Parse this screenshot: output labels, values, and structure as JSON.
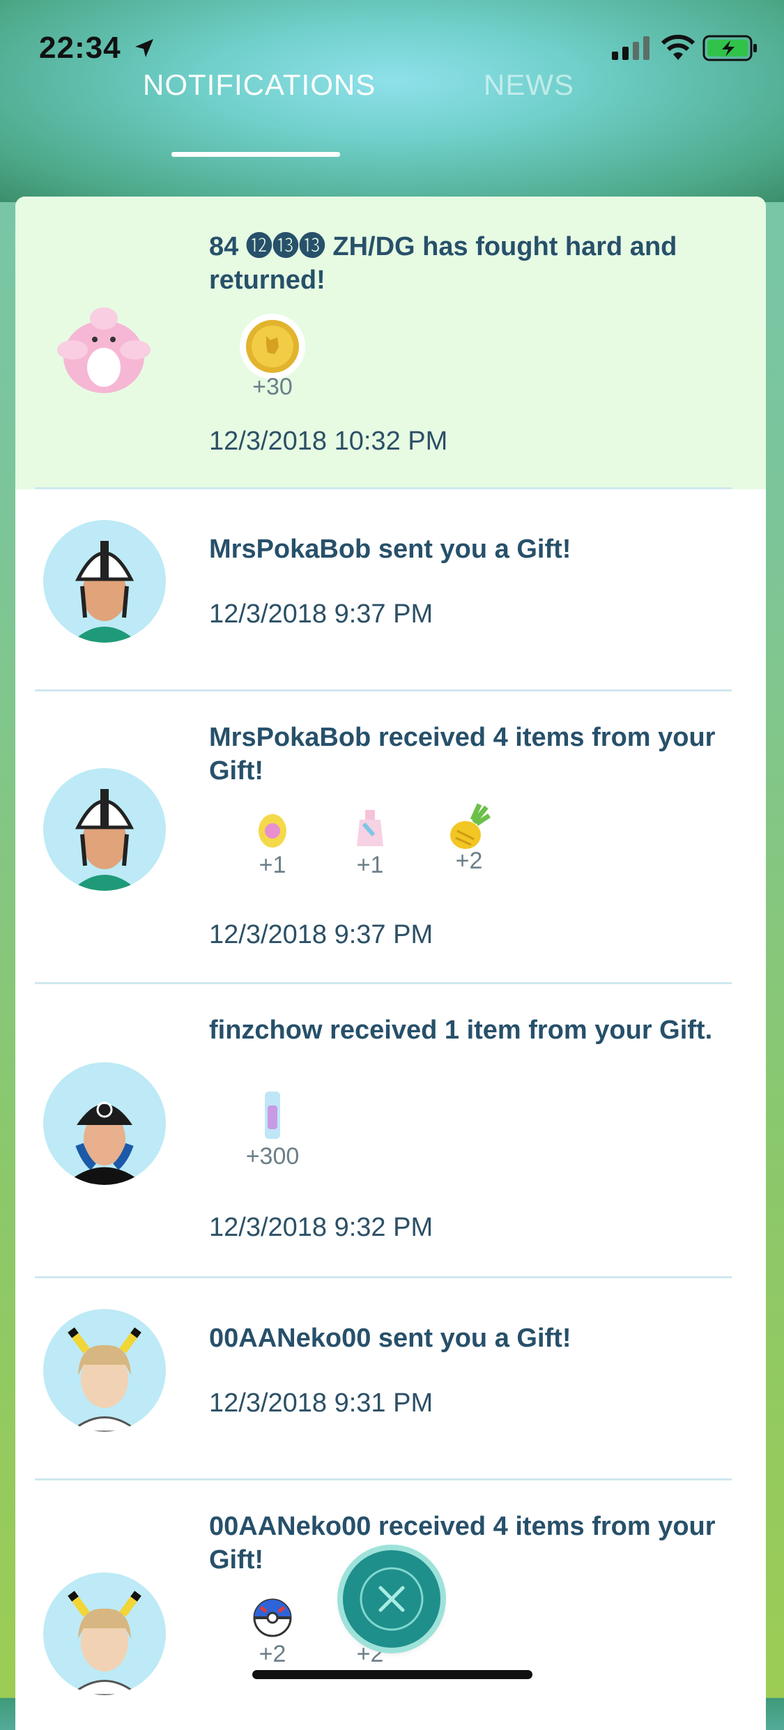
{
  "status": {
    "time": "22:34"
  },
  "tabs": [
    {
      "label": "NOTIFICATIONS",
      "active": true
    },
    {
      "label": "NEWS",
      "active": false
    }
  ],
  "notifications": [
    {
      "message": "84 ⓬⓭⓭ ZH/DG has fought hard and returned!",
      "rewards": [
        {
          "icon": "pokecoin-icon",
          "count": "+30"
        }
      ],
      "time": "12/3/2018 10:32 PM",
      "avatar": "blissey-avatar",
      "highlight": true
    },
    {
      "message": "MrsPokaBob sent you a Gift!",
      "rewards": [],
      "time": "12/3/2018 9:37 PM",
      "avatar": "trainer-avatar-helmet"
    },
    {
      "message": "MrsPokaBob received 4 items from your Gift!",
      "rewards": [
        {
          "icon": "egg-icon",
          "count": "+1"
        },
        {
          "icon": "potion-icon",
          "count": "+1"
        },
        {
          "icon": "pinap-berry-icon",
          "count": "+2"
        }
      ],
      "time": "12/3/2018 9:37 PM",
      "avatar": "trainer-avatar-helmet"
    },
    {
      "message": "finzchow received 1 item from your Gift.",
      "rewards": [
        {
          "icon": "stardust-icon",
          "count": "+300"
        }
      ],
      "time": "12/3/2018 9:32 PM",
      "avatar": "trainer-avatar-cap"
    },
    {
      "message": "00AANeko00 sent you a Gift!",
      "rewards": [],
      "time": "12/3/2018 9:31 PM",
      "avatar": "trainer-avatar-pikachu"
    },
    {
      "message": "00AANeko00 received 4 items from your Gift!",
      "rewards": [
        {
          "icon": "great-ball-icon",
          "count": "+2"
        },
        {
          "icon": "ultra-ball-icon",
          "count": "+2"
        }
      ],
      "time": "",
      "avatar": "trainer-avatar-pikachu"
    }
  ],
  "colors": {
    "accent": "#27506a",
    "highlight_bg": "#e7fbe3",
    "divider": "#cfe8ef",
    "close_button": "#1f8f8b"
  }
}
